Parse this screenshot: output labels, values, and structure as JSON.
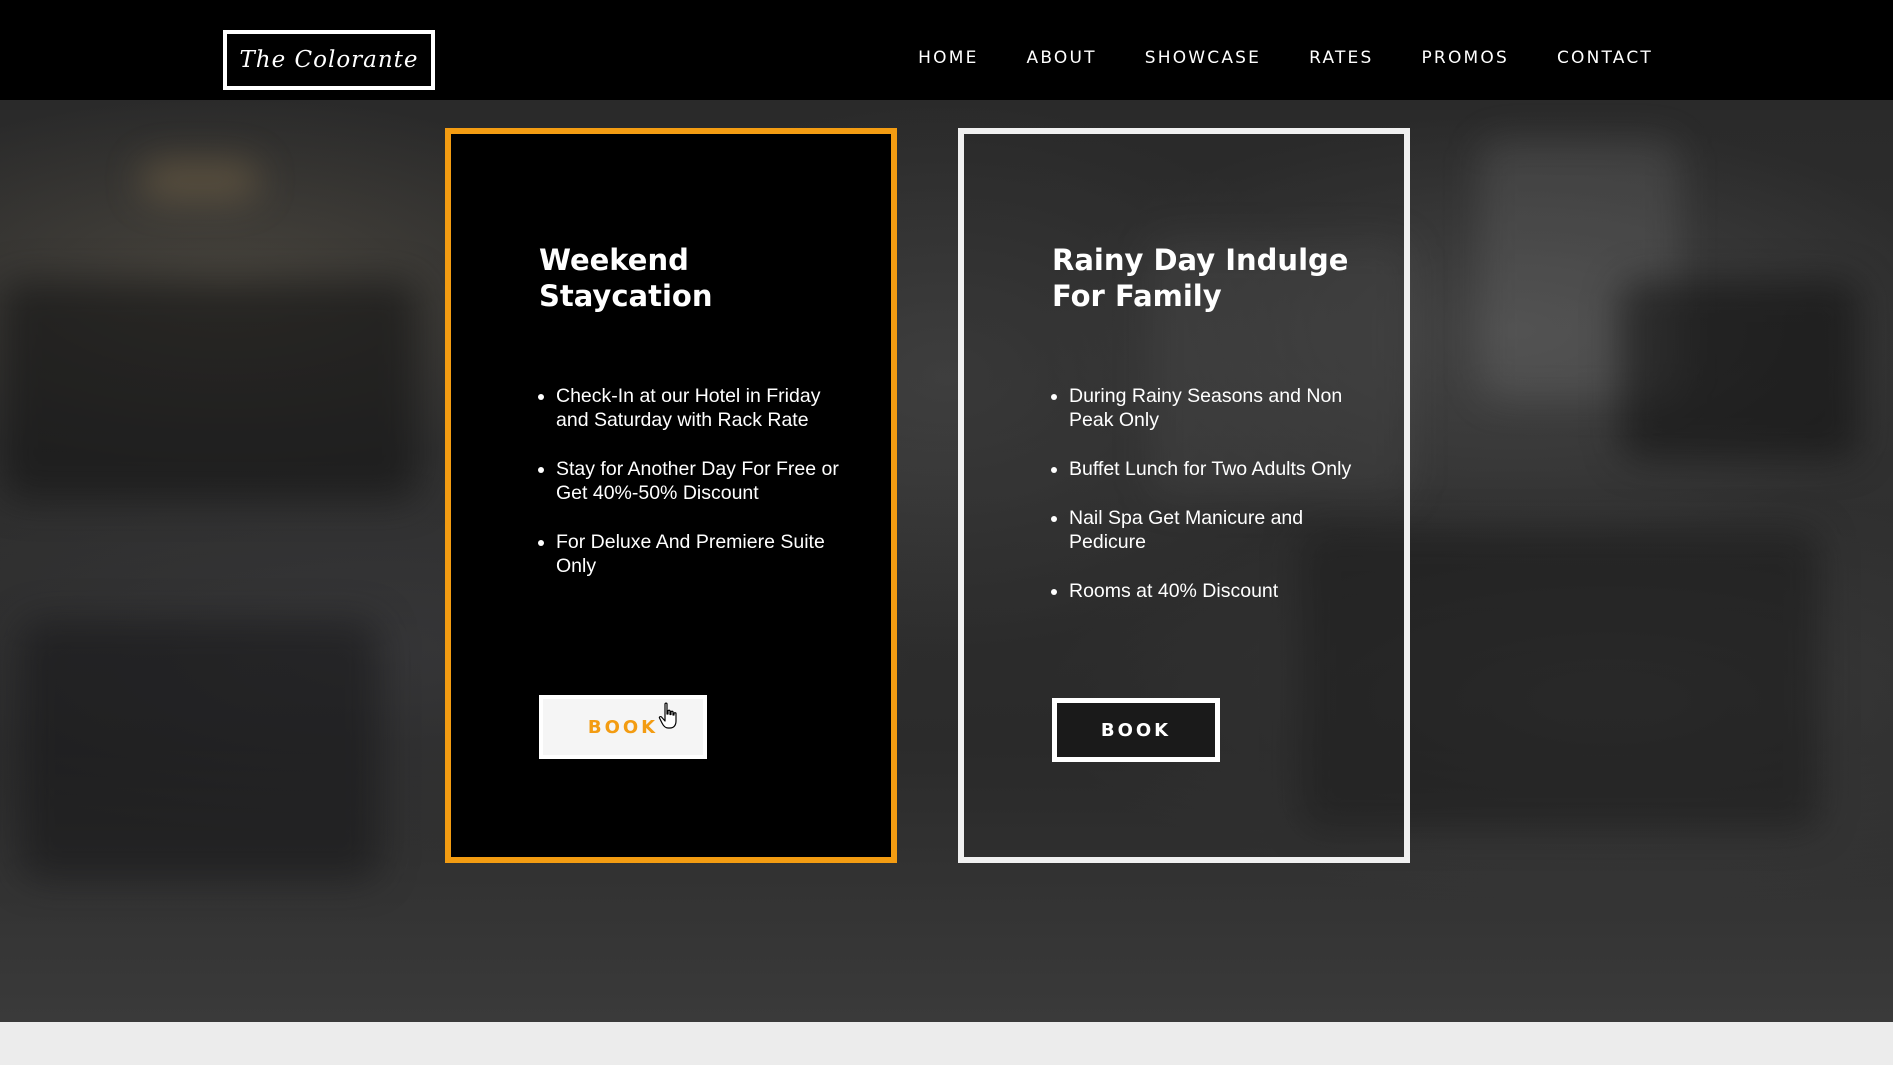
{
  "header": {
    "logo": "The Colorante",
    "nav": [
      "HOME",
      "ABOUT",
      "SHOWCASE",
      "RATES",
      "PROMOS",
      "CONTACT"
    ]
  },
  "promos": [
    {
      "title_line1": "Weekend",
      "title_line2": "Staycation",
      "items": [
        "Check-In at our Hotel in Friday and Saturday with Rack Rate",
        "Stay for Another Day For Free or Get 40%-50% Discount",
        "For Deluxe And Premiere Suite Only"
      ],
      "button": "BOOK"
    },
    {
      "title_line1": "Rainy Day Indulge",
      "title_line2": "For Family",
      "items": [
        "During Rainy Seasons and Non Peak Only",
        "Buffet Lunch for Two Adults Only",
        "Nail Spa Get Manicure and Pedicure",
        "Rooms at 40% Discount"
      ],
      "button": "BOOK"
    }
  ],
  "colors": {
    "accent": "#f39c12",
    "header_bg": "#000000",
    "card_border_alt": "#f0f0f0"
  }
}
